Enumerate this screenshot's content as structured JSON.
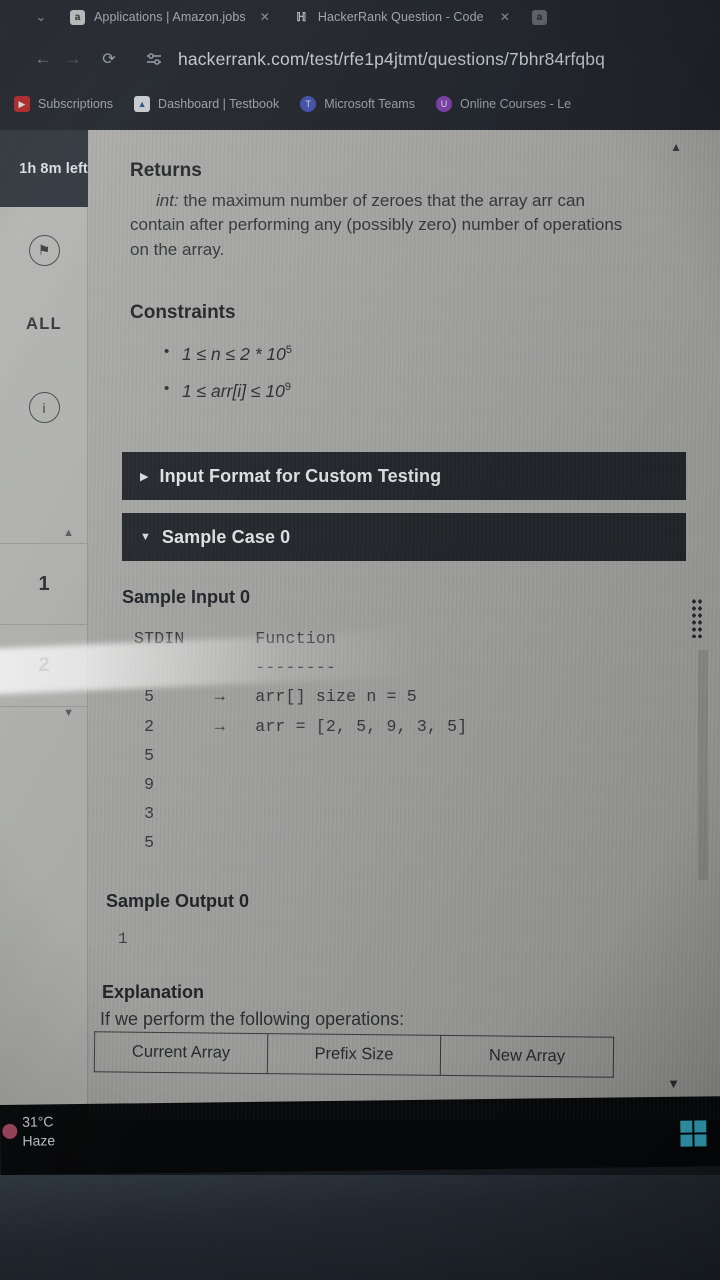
{
  "browser": {
    "tab_list_chevron": "⌄",
    "tabs": [
      {
        "title": "Applications | Amazon.jobs",
        "favicon_name": "amazon-favicon",
        "favicon_glyph": "a",
        "favicon_color": "#d9dadc",
        "close": "✕"
      },
      {
        "title": "HackerRank Question - Code C",
        "favicon_name": "hackerrank-favicon",
        "favicon_glyph": "ℍ",
        "favicon_color": "#2f3338",
        "close": "✕"
      },
      {
        "title": "",
        "favicon_name": "amazon-favicon-2",
        "favicon_glyph": "a",
        "favicon_color": "#4a4d52",
        "close": ""
      }
    ],
    "nav": {
      "back": "←",
      "forward": "→",
      "reload": "⟳",
      "site_settings_icon": "site-settings-icon",
      "url": "hackerrank.com/test/rfe1p4jtmt/questions/7bhr84rfqbq"
    },
    "bookmarks": [
      {
        "label": "Subscriptions",
        "icon_name": "youtube-icon",
        "glyph": "▶",
        "color": "#cc2b2b"
      },
      {
        "label": "Dashboard | Testbook",
        "icon_name": "testbook-icon",
        "glyph": "▲",
        "color": "#e7eaee"
      },
      {
        "label": "Microsoft Teams",
        "icon_name": "teams-icon",
        "glyph": "T",
        "color": "#4a5bc4"
      },
      {
        "label": "Online Courses - Le",
        "icon_name": "courses-icon",
        "glyph": "U",
        "color": "#9147c4"
      }
    ]
  },
  "app": {
    "timer": "1h 8m left",
    "rail": {
      "flag_icon": "flag-icon",
      "flag_glyph": "⚑",
      "all_label": "ALL",
      "info_icon": "info-icon",
      "info_glyph": "i"
    },
    "question_nav": {
      "up_arrow": "▲",
      "down_arrow": "▼",
      "items": [
        "1",
        "2"
      ]
    },
    "scroll": {
      "up_arrow": "▲",
      "down_arrow": "▼"
    }
  },
  "question": {
    "returns": {
      "heading": "Returns",
      "type_label": "int:",
      "body": " the maximum number of zeroes that the array arr can contain after performing any (possibly zero) number of operations on the array."
    },
    "constraints": {
      "heading": "Constraints",
      "items": [
        {
          "prefix": "1 ≤ n ≤ 2 * 10",
          "exponent": "5"
        },
        {
          "prefix": "1 ≤ arr[i] ≤ 10",
          "exponent": "9"
        }
      ]
    },
    "sections": [
      {
        "label": "Input Format for Custom Testing",
        "caret": "▶",
        "expanded": false
      },
      {
        "label": "Sample Case 0",
        "caret": "▼",
        "expanded": true
      }
    ],
    "sample_input": {
      "heading": "Sample Input 0",
      "code": "STDIN       Function\n            --------\n 5      →   arr[] size n = 5\n 2      →   arr = [2, 5, 9, 3, 5]\n 5\n 9\n 3\n 5"
    },
    "sample_output": {
      "heading": "Sample Output 0",
      "code": "1"
    },
    "explanation": {
      "heading": "Explanation",
      "text": "If we perform the following operations:",
      "table_headers": [
        "Current Array",
        "Prefix Size",
        "New Array"
      ]
    }
  },
  "taskbar": {
    "weather_temp": "31°C",
    "weather_cond": "Haze",
    "windows_icon": "windows-logo-icon"
  }
}
